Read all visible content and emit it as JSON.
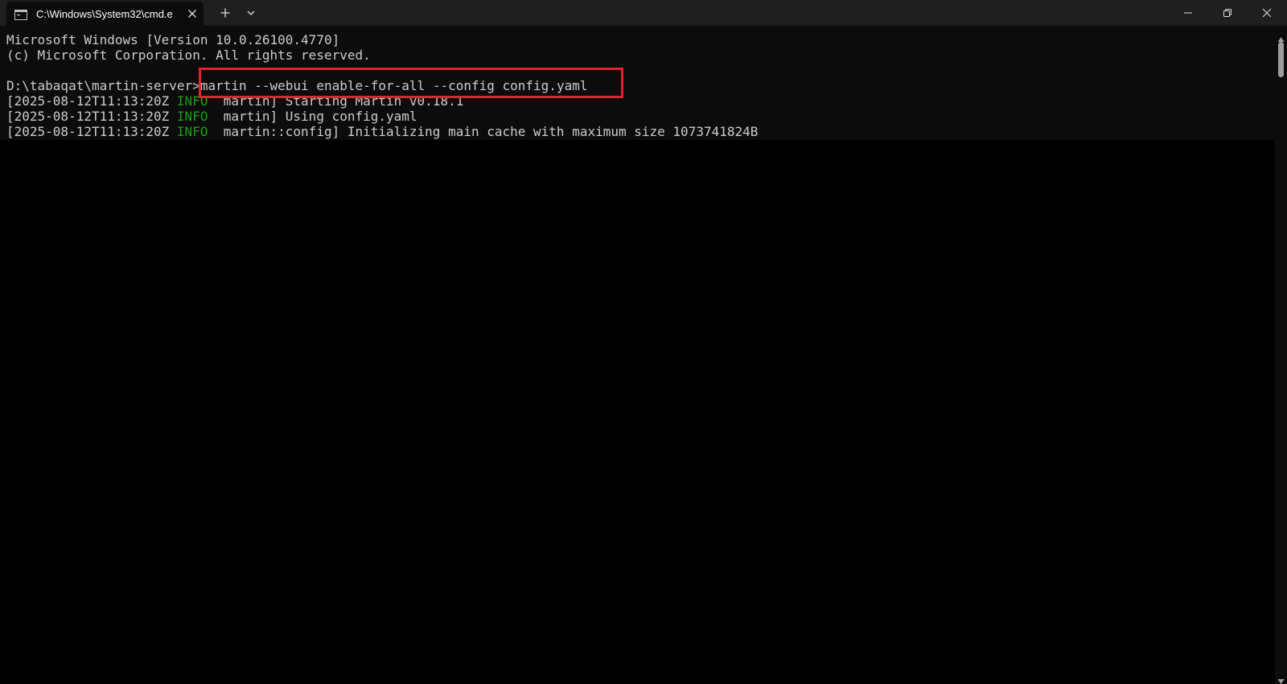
{
  "window": {
    "tab_title": "C:\\Windows\\System32\\cmd.e",
    "icons": {
      "tab": "terminal-icon",
      "tab_close": "close-icon",
      "new_tab": "plus-icon",
      "dropdown": "chevron-down-icon",
      "minimize": "minimize-icon",
      "maximize": "restore-icon",
      "close": "close-icon"
    }
  },
  "console": {
    "lines": [
      {
        "text": "Microsoft Windows [Version 10.0.26100.4770]"
      },
      {
        "text": "(c) Microsoft Corporation. All rights reserved."
      },
      {
        "text": ""
      },
      {
        "prompt": "D:\\tabaqat\\martin-server>",
        "command": "martin --webui enable-for-all --config config.yaml"
      },
      {
        "timestamp": "[2025-08-12T11:13:20Z ",
        "level": "INFO",
        "message": "  martin] Starting Martin v0.18.1"
      },
      {
        "timestamp": "[2025-08-12T11:13:20Z ",
        "level": "INFO",
        "message": "  martin] Using config.yaml"
      },
      {
        "timestamp": "[2025-08-12T11:13:20Z ",
        "level": "INFO",
        "message": "  martin::config] Initializing main cache with maximum size 1073741824B"
      }
    ]
  },
  "colors": {
    "background": "#0c0c0c",
    "text": "#cccccc",
    "info": "#13a10e",
    "highlight": "#e0232f",
    "titlebar": "#1f1f1f"
  }
}
